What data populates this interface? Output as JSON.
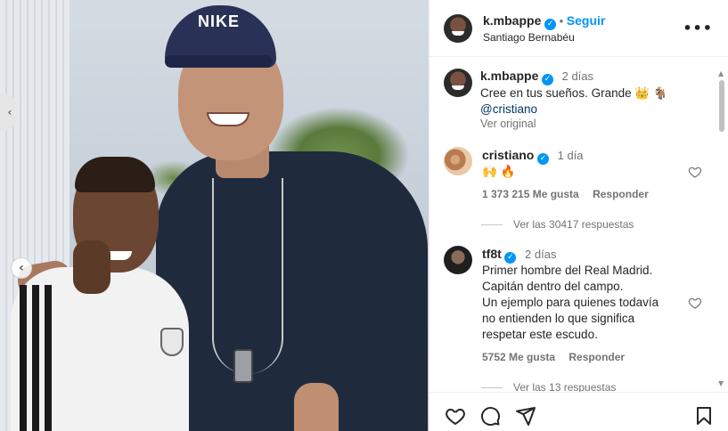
{
  "post": {
    "photo_alt": ""
  },
  "header": {
    "username": "k.mbappe",
    "follow_label": "Seguir",
    "location": "Santiago Bernabéu",
    "more_icon": "more-icon"
  },
  "caption": {
    "username": "k.mbappe",
    "time": "2 días",
    "text": "Cree en tus sueños. Grande 👑 🐐",
    "mention": "@cristiano",
    "see_original": "Ver original"
  },
  "comments": [
    {
      "username": "cristiano",
      "time": "1 día",
      "text": "🙌 🔥",
      "likes": "1 373 215 Me gusta",
      "reply_label": "Responder",
      "view_replies": "Ver las 30417 respuestas"
    },
    {
      "username": "tf8t",
      "time": "2 días",
      "lines": [
        "Primer hombre del Real Madrid.",
        "Capitán dentro del campo.",
        "Un ejemplo para quienes todavía",
        "no entienden lo que significa",
        "respetar este escudo."
      ],
      "likes": "5752 Me gusta",
      "reply_label": "Responder",
      "view_replies": "Ver las 13 respuestas"
    }
  ],
  "image_overlay": {
    "cap_logo_text": "NIKE"
  },
  "colors": {
    "accent": "#0095f6",
    "muted": "#737373",
    "text": "#262626"
  }
}
